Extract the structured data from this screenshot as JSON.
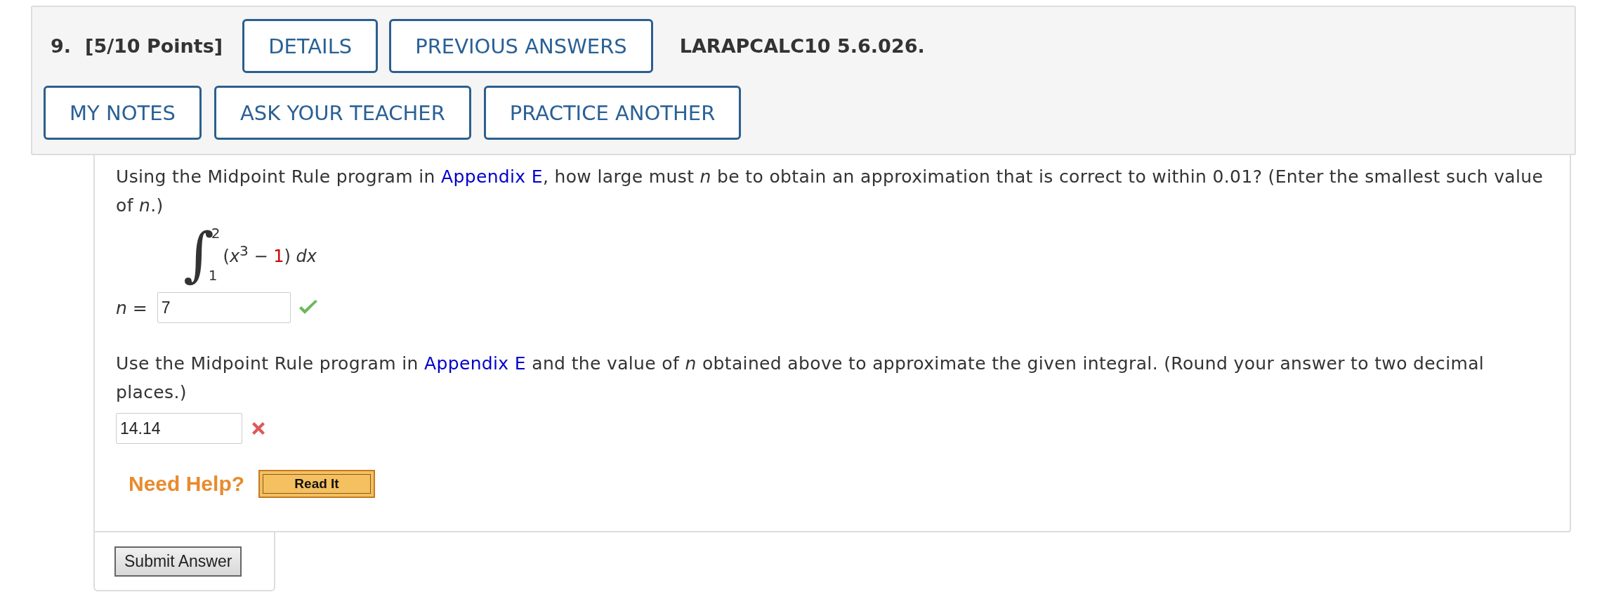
{
  "header": {
    "number": "9.",
    "points": "[5/10 Points]",
    "code": "LARAPCALC10 5.6.026.",
    "row1_buttons": [
      "DETAILS",
      "PREVIOUS ANSWERS"
    ],
    "row2_buttons": [
      "MY NOTES",
      "ASK YOUR TEACHER",
      "PRACTICE ANOTHER"
    ]
  },
  "parts": [
    {
      "kind": "prompt",
      "segments": [
        {
          "kind": "text",
          "text": "Using the Midpoint Rule program in "
        },
        {
          "kind": "link",
          "text": "Appendix E"
        },
        {
          "kind": "text",
          "text": ", how large must *n* be to obtain an approximation that is correct to within 0.01? (Enter the smallest such value of *n*.)"
        }
      ]
    },
    {
      "kind": "integral",
      "symbol": "∫",
      "lower": "1",
      "upper": "2",
      "head": "(*x*$^{3}$ − ",
      "highlight": "1",
      "tail": ") *dx*"
    },
    {
      "kind": "answer",
      "label": "*n* =",
      "value": "7",
      "correct": true
    },
    {
      "kind": "prompt",
      "segments": [
        {
          "kind": "text",
          "text": "Use the Midpoint Rule program in "
        },
        {
          "kind": "link",
          "text": "Appendix E"
        },
        {
          "kind": "text",
          "text": " and the value of *n* obtained above to approximate the given integral. (Round your answer to two decimal places.)"
        }
      ]
    },
    {
      "kind": "answer",
      "value": "14.14",
      "correct": false
    }
  ],
  "help": {
    "label": "Need Help?",
    "buttons": [
      "Read It"
    ]
  },
  "submit": "Submit Answer"
}
